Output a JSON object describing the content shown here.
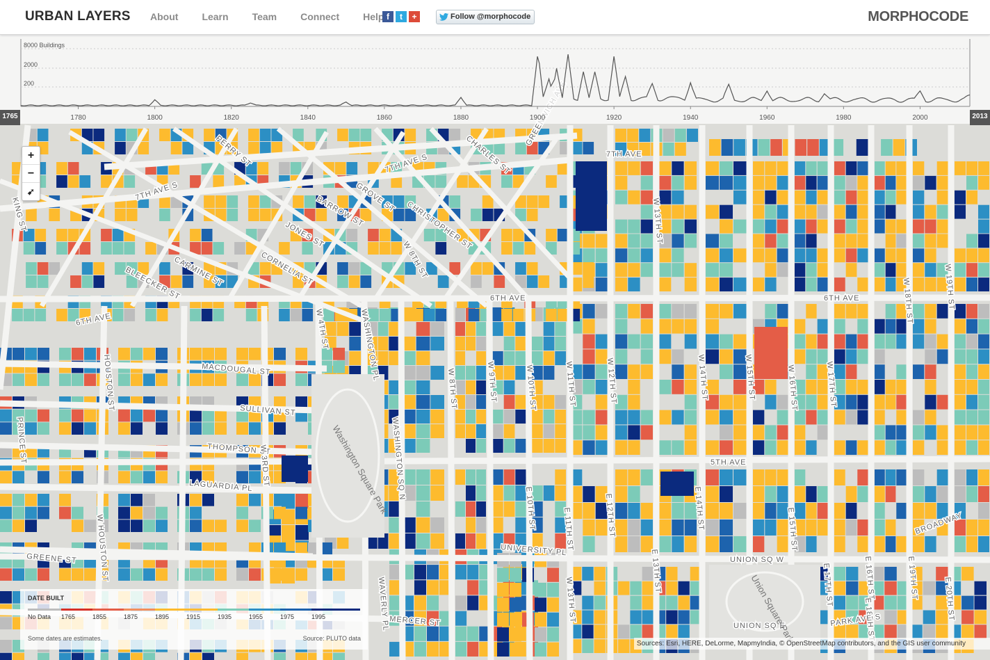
{
  "header": {
    "app_title": "URBAN LAYERS",
    "nav": [
      "About",
      "Learn",
      "Team",
      "Connect",
      "Help"
    ],
    "social": [
      {
        "icon": "facebook-icon",
        "glyph": "f",
        "color": "#3b5998"
      },
      {
        "icon": "twitter-icon",
        "glyph": "t",
        "color": "#2fa9e0"
      },
      {
        "icon": "google-plus-icon",
        "glyph": "+",
        "color": "#dd4b39"
      }
    ],
    "follow_label": "Follow @morphocode",
    "brand": "MORPHOCODE"
  },
  "timeline": {
    "y_labels": [
      "8000 Buildings",
      "2000",
      "200"
    ],
    "x_labels": [
      "1780",
      "1800",
      "1820",
      "1840",
      "1860",
      "1880",
      "1900",
      "1920",
      "1940",
      "1960",
      "1980",
      "2000"
    ],
    "start_year": "1765",
    "end_year": "2013"
  },
  "zoom": {
    "zoom_in": "+",
    "zoom_out": "−",
    "locate": "➹"
  },
  "streets": [
    "7TH AVE",
    "7TH AVE S",
    "7TH AVE S",
    "BARROW ST",
    "GROVE ST",
    "CHRISTOPHER ST",
    "JONES ST",
    "CARMINE ST",
    "CORNELIA ST",
    "BLEECKER ST",
    "6TH AVE",
    "6TH AVE",
    "6TH AVE",
    "W 4TH ST",
    "WASHINGTON PL",
    "MACDOUGAL ST",
    "SULLIVAN ST",
    "THOMPSON ST",
    "LAGUARDIA PL",
    "W 3RD ST",
    "WASHINGTON SQ N",
    "W 8TH ST",
    "W 9TH ST",
    "W 10TH ST",
    "W 11TH ST",
    "W 12TH ST",
    "W 13TH ST",
    "W 14TH ST",
    "W 15TH ST",
    "W 16TH ST",
    "W 17TH ST",
    "W 18TH ST",
    "W 19TH ST",
    "5TH AVE",
    "E 10TH ST",
    "E 11TH ST",
    "E 12TH ST",
    "E 13TH ST",
    "E 14TH ST",
    "E 15TH ST",
    "E 16TH ST",
    "E 17TH ST",
    "E 18TH ST",
    "E 19TH ST",
    "E 20TH ST",
    "UNIVERSITY PL",
    "UNION SQ W",
    "UNION SQ E",
    "PARK AVE S",
    "BROADWAY",
    "GREENE ST",
    "MERCER ST",
    "WAVERLY PL",
    "W HOUSTON ST",
    "HOUSTON ST",
    "KING ST",
    "PRINCE ST",
    "GREENWICH AVE",
    "CHARLES ST",
    "PERRY ST",
    "W 13TH ST",
    "W 8TH ST"
  ],
  "parks": [
    "Washington Square Park",
    "Union Square Park"
  ],
  "legend": {
    "title": "DATE BUILT",
    "labels": [
      "No Data",
      "1765",
      "1855",
      "1875",
      "1895",
      "1915",
      "1935",
      "1955",
      "1975",
      "1995"
    ],
    "colors": [
      "#bdbdbd",
      "#d73027",
      "#e45d47",
      "#f28e5c",
      "#fdbb2e",
      "#fdbb2e",
      "#7ccbb8",
      "#2c8fc4",
      "#1d63ad",
      "#0b2a7e"
    ],
    "note": "Some dates are estimates.",
    "source": "Source: PLUTO data"
  },
  "attribution": "Sources: Esri, HERE, DeLorme, MapmyIndia, © OpenStreetMap contributors, and the GIS user community"
}
